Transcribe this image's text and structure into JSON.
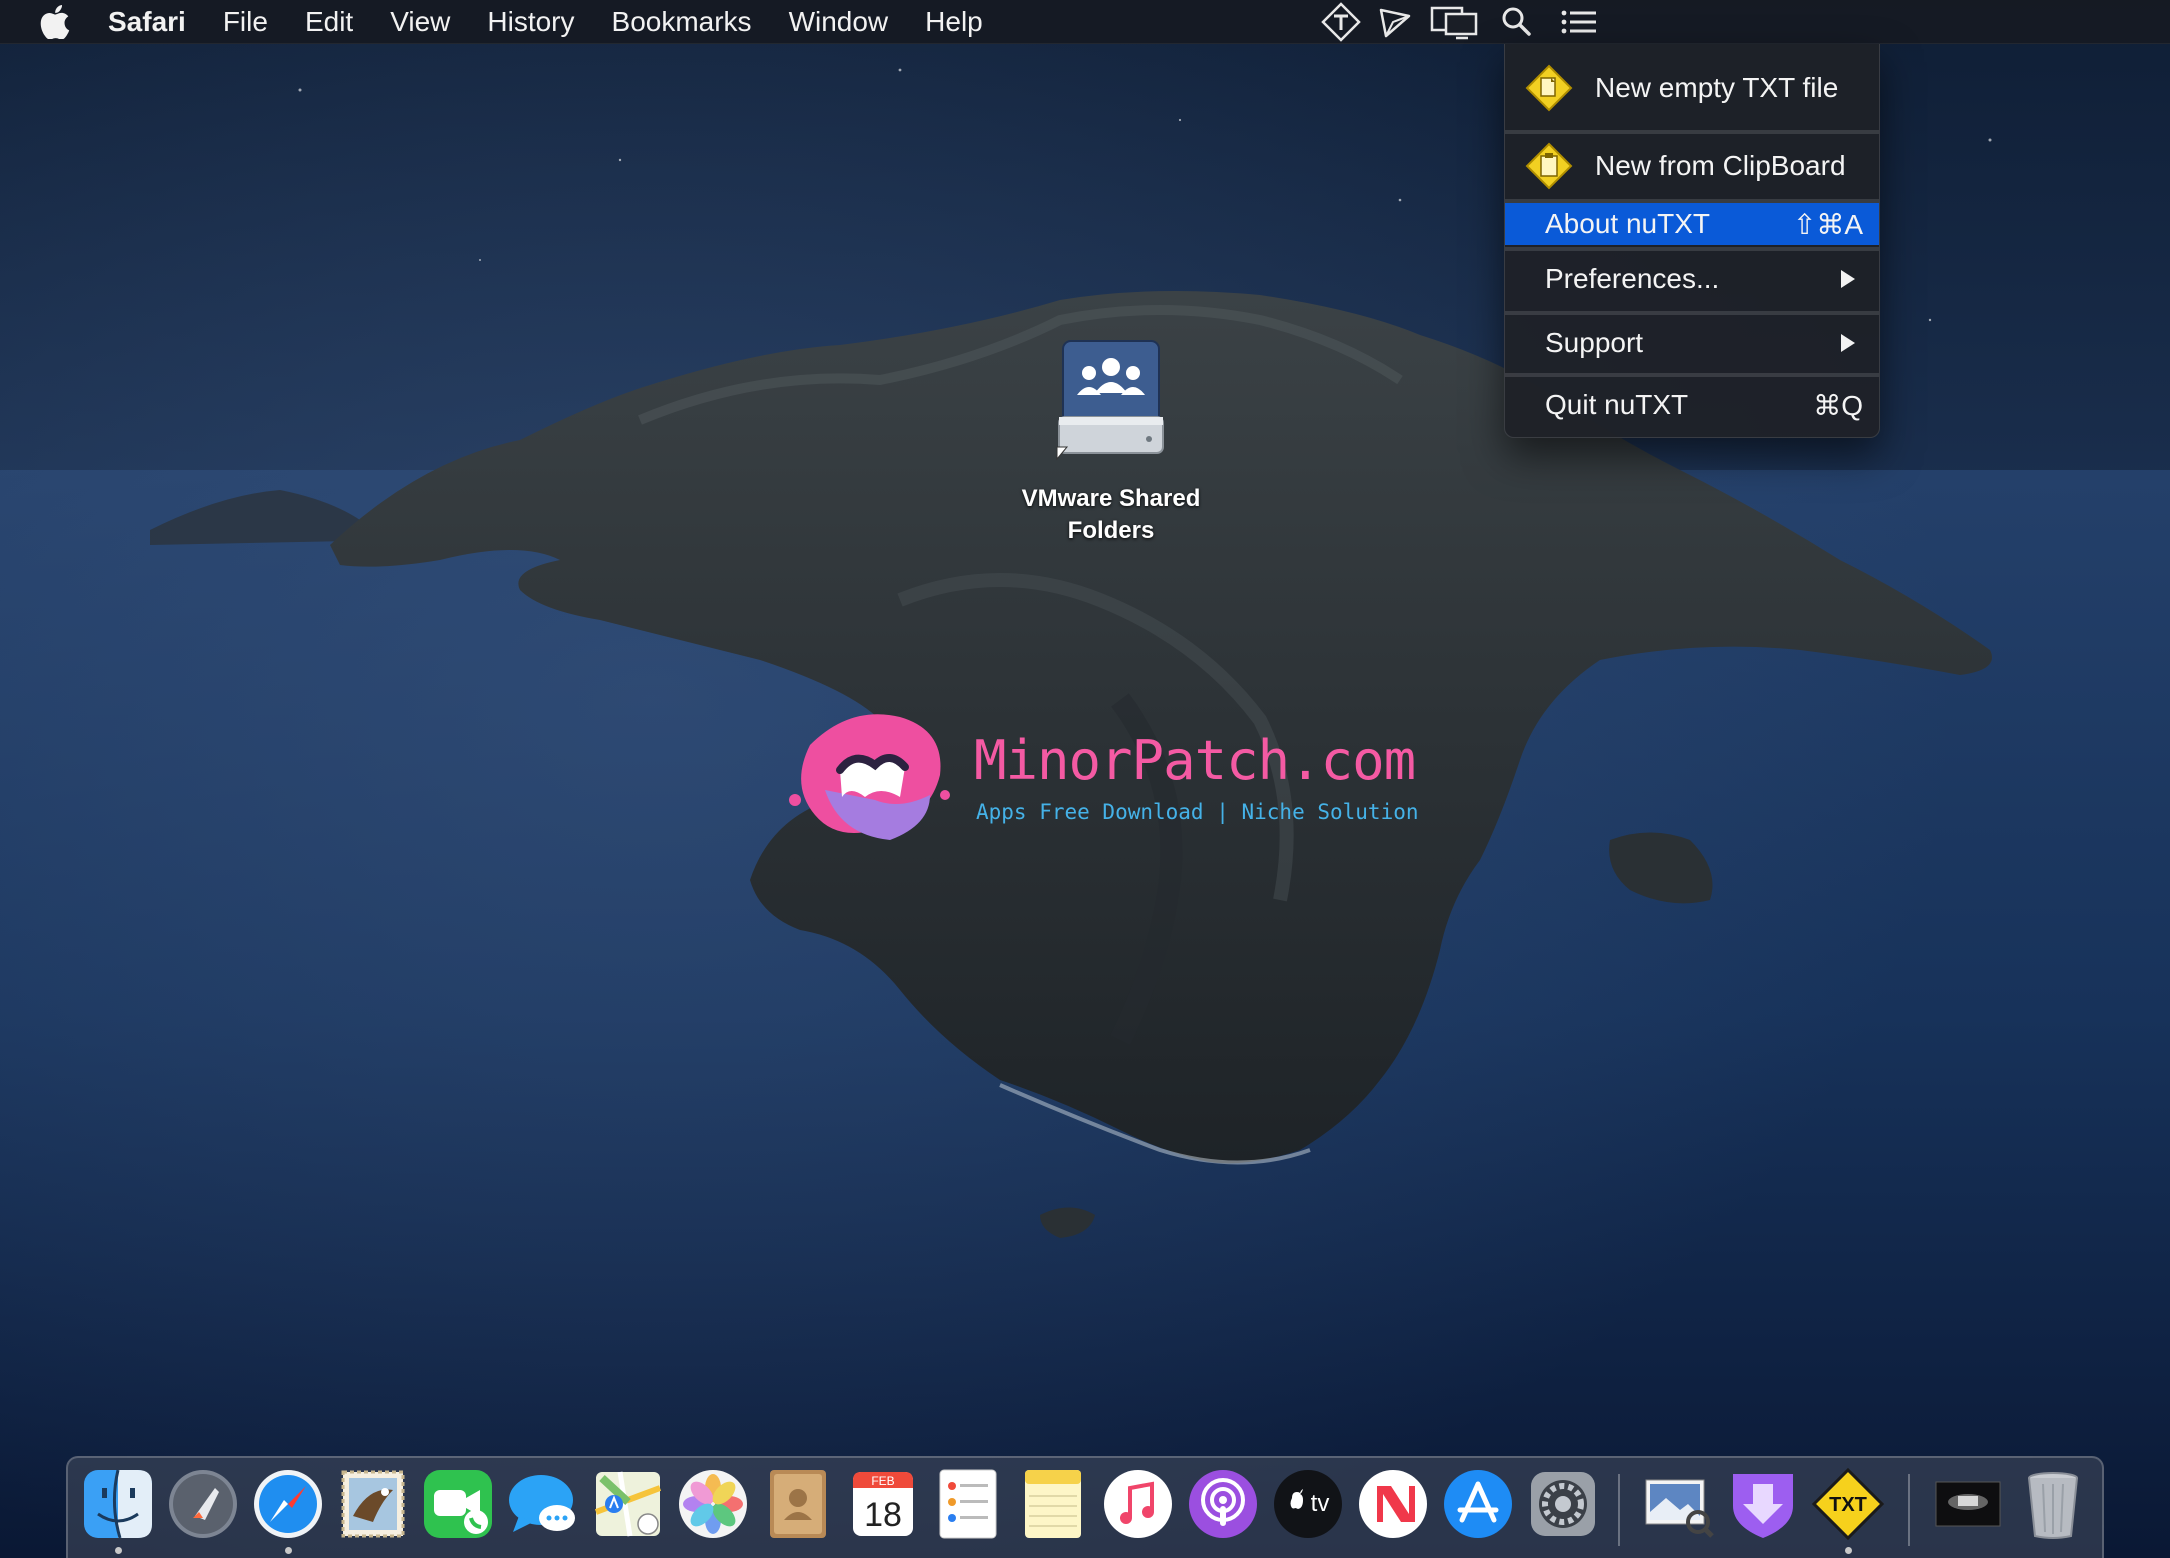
{
  "menubar": {
    "apple_icon": "apple-logo-icon",
    "app_name": "Safari",
    "items": [
      "File",
      "Edit",
      "View",
      "History",
      "Bookmarks",
      "Window",
      "Help"
    ],
    "status_icons": [
      "nutxt-icon",
      "send-icon",
      "display-mirroring-icon",
      "spotlight-search-icon",
      "notification-center-icon"
    ]
  },
  "dropdown": {
    "items": [
      {
        "label": "New empty TXT file",
        "icon": "new-txt-file-icon"
      },
      {
        "label": "New from ClipBoard",
        "icon": "clipboard-icon"
      },
      {
        "label": "About nuTXT",
        "shortcut": "⇧⌘A",
        "highlighted": true
      },
      {
        "label": "Preferences...",
        "submenu": true
      },
      {
        "label": "Support",
        "submenu": true
      },
      {
        "label": "Quit nuTXT",
        "shortcut": "⌘Q"
      }
    ]
  },
  "desktop": {
    "icon_label_line1": "VMware Shared",
    "icon_label_line2": "Folders"
  },
  "watermark": {
    "title": "MinorPatch.com",
    "subtitle": "Apps Free Download | Niche Solution"
  },
  "dock": {
    "apps": [
      {
        "name": "Finder",
        "icon": "finder-icon",
        "running": true
      },
      {
        "name": "Launchpad",
        "icon": "launchpad-icon",
        "running": false
      },
      {
        "name": "Safari",
        "icon": "safari-icon",
        "running": true
      },
      {
        "name": "Mail",
        "icon": "mail-icon",
        "running": false
      },
      {
        "name": "FaceTime",
        "icon": "facetime-icon",
        "running": false
      },
      {
        "name": "Messages",
        "icon": "messages-icon",
        "running": false
      },
      {
        "name": "Maps",
        "icon": "maps-icon",
        "running": false
      },
      {
        "name": "Photos",
        "icon": "photos-icon",
        "running": false
      },
      {
        "name": "Contacts",
        "icon": "contacts-icon",
        "running": false
      },
      {
        "name": "Calendar",
        "icon": "calendar-icon",
        "running": false
      },
      {
        "name": "Reminders",
        "icon": "reminders-icon",
        "running": false
      },
      {
        "name": "Notes",
        "icon": "notes-icon",
        "running": false
      },
      {
        "name": "Music",
        "icon": "music-icon",
        "running": false
      },
      {
        "name": "Podcasts",
        "icon": "podcasts-icon",
        "running": false
      },
      {
        "name": "TV",
        "icon": "apple-tv-icon",
        "running": false
      },
      {
        "name": "News",
        "icon": "news-icon",
        "running": false
      },
      {
        "name": "App Store",
        "icon": "app-store-icon",
        "running": false
      },
      {
        "name": "System Preferences",
        "icon": "system-preferences-icon",
        "running": false
      },
      {
        "name": "Preview",
        "icon": "preview-icon",
        "running": false
      },
      {
        "name": "Downloads",
        "icon": "downloads-shield-icon",
        "running": false
      },
      {
        "name": "nuTXT",
        "icon": "nutxt-app-icon",
        "running": true
      },
      {
        "name": "Screen",
        "icon": "screenshot-stack-icon",
        "running": false
      },
      {
        "name": "Trash",
        "icon": "trash-icon",
        "running": false
      }
    ],
    "calendar_month": "FEB",
    "calendar_day": "18",
    "tv_label": "tv",
    "nutxt_label": "TXT"
  }
}
